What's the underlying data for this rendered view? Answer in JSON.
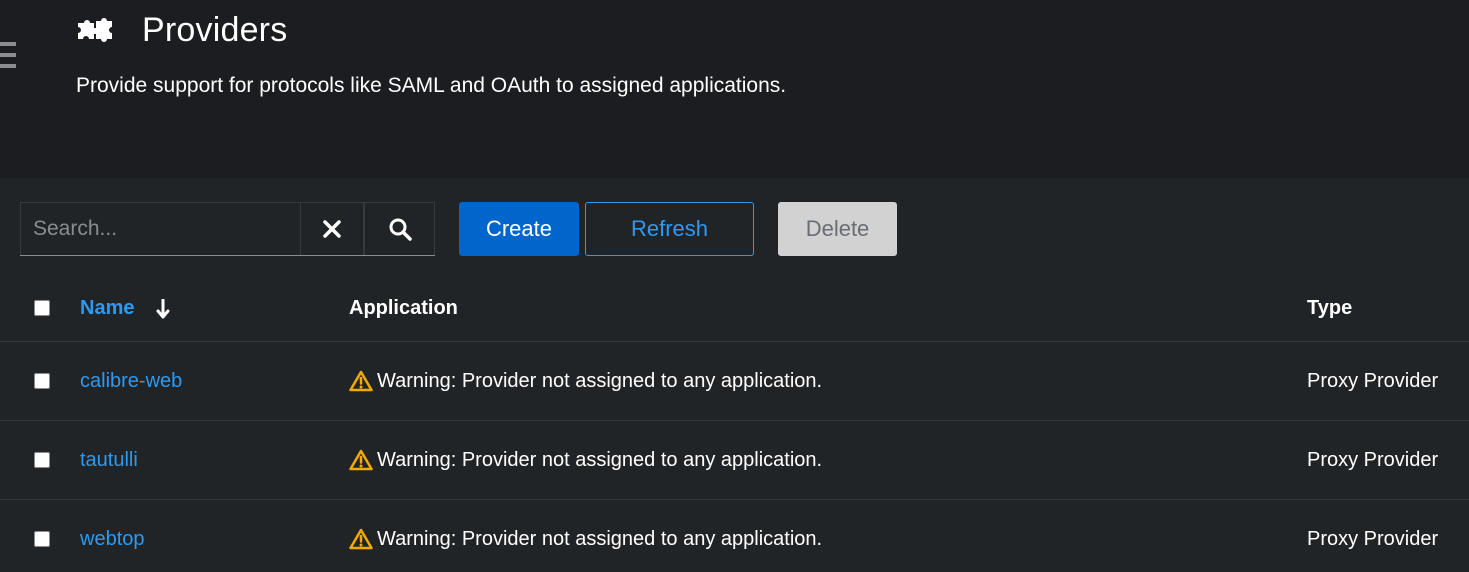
{
  "header": {
    "title": "Providers",
    "description": "Provide support for protocols like SAML and OAuth to assigned applications.",
    "icon": "puzzle-piece-icon"
  },
  "toolbar": {
    "search_placeholder": "Search...",
    "search_value": "",
    "clear_icon": "close-icon",
    "search_icon": "search-icon",
    "create_label": "Create",
    "refresh_label": "Refresh",
    "delete_label": "Delete"
  },
  "table": {
    "columns": {
      "name": "Name",
      "application": "Application",
      "type": "Type"
    },
    "sort": {
      "column": "Name",
      "direction": "descending",
      "icon": "arrow-down-icon"
    },
    "rows": [
      {
        "name": "calibre-web",
        "application": "Warning: Provider not assigned to any application.",
        "type": "Proxy Provider"
      },
      {
        "name": "tautulli",
        "application": "Warning: Provider not assigned to any application.",
        "type": "Proxy Provider"
      },
      {
        "name": "webtop",
        "application": "Warning: Provider not assigned to any application.",
        "type": "Proxy Provider"
      }
    ]
  },
  "colors": {
    "primary": "#0066cc",
    "link": "#2b9af3",
    "warning": "#f0ab00",
    "disabled_bg": "#d2d2d2"
  }
}
